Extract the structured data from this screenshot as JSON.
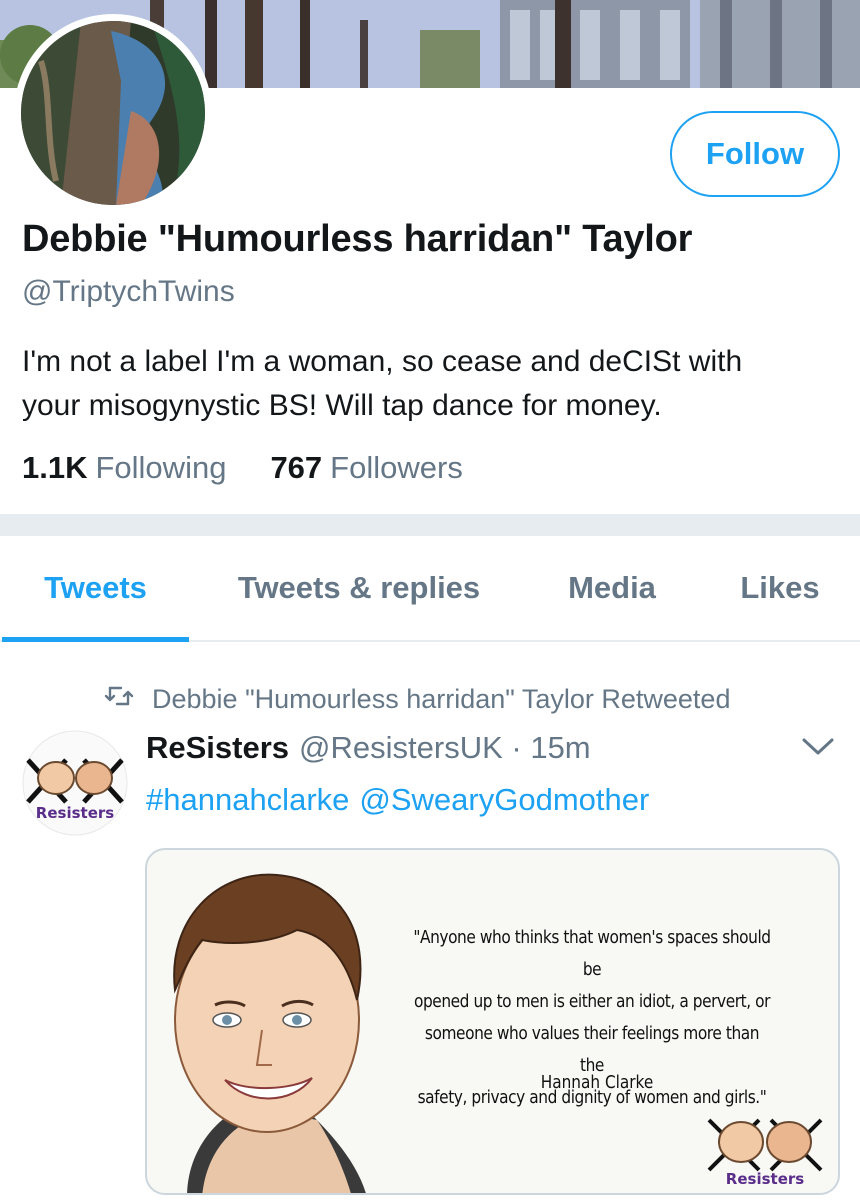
{
  "profile": {
    "follow_label": "Follow",
    "display_name": "Debbie \"Humourless harridan\" Taylor",
    "handle": "@TriptychTwins",
    "bio_line1": "I'm not a label I'm a woman, so cease and deCISt with",
    "bio_line2": "your misogynystic BS! Will tap dance for money.",
    "following_count": "1.1K",
    "following_label": "Following",
    "followers_count": "767",
    "followers_label": "Followers"
  },
  "tabs": [
    {
      "label": "Tweets",
      "active": true
    },
    {
      "label": "Tweets & replies",
      "active": false
    },
    {
      "label": "Media",
      "active": false
    },
    {
      "label": "Likes",
      "active": false
    }
  ],
  "tweet": {
    "retweet_context": "Debbie \"Humourless harridan\" Taylor Retweeted",
    "author_name": "ReSisters",
    "author_handle": "@ResistersUK",
    "time": "· 15m",
    "hashtag": "#hannahclarke",
    "mention": "@SwearyGodmother",
    "avatar_logo_text": "Resisters",
    "media": {
      "quote_line1": "\"Anyone who thinks that women's spaces should be",
      "quote_line2": "opened up to men is either an idiot, a pervert, or",
      "quote_line3": "someone who values their feelings more than the",
      "quote_line4": "safety, privacy and dignity of women and girls.\"",
      "quote_author": "Hannah Clarke",
      "logo_text": "Resisters"
    }
  },
  "colors": {
    "accent": "#1da1f2",
    "secondary_text": "#657786",
    "primary_text": "#14171a",
    "separator": "#e6ecf0"
  },
  "icons": [
    "retweet-icon",
    "chevron-down-icon"
  ]
}
